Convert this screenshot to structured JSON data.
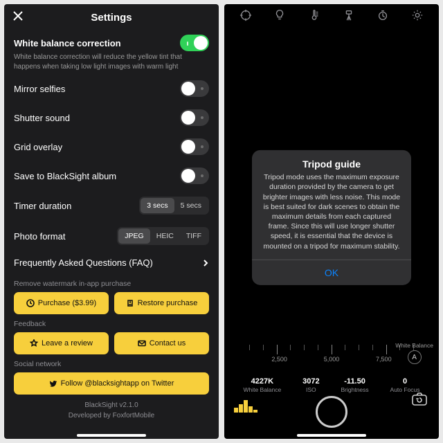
{
  "settings": {
    "title": "Settings",
    "wb": {
      "label": "White balance correction",
      "on": true,
      "desc": "White balance correction will reduce the yellow tint that happens when taking low light images with warm light"
    },
    "mirror": {
      "label": "Mirror selfies",
      "on": false
    },
    "shutter": {
      "label": "Shutter sound",
      "on": false
    },
    "grid": {
      "label": "Grid overlay",
      "on": false
    },
    "save": {
      "label": "Save to BlackSight album",
      "on": false
    },
    "timer": {
      "label": "Timer duration",
      "options": [
        "3 secs",
        "5 secs"
      ],
      "selected": 0
    },
    "format": {
      "label": "Photo format",
      "options": [
        "JPEG",
        "HEIC",
        "TIFF"
      ],
      "selected": 0
    },
    "faq": {
      "label": "Frequently Asked Questions (FAQ)"
    },
    "iap": {
      "header": "Remove watermark in-app purchase",
      "purchase": "Purchase ($3.99)",
      "restore": "Restore purchase"
    },
    "feedback": {
      "header": "Feedback",
      "review": "Leave a review",
      "contact": "Contact us"
    },
    "social": {
      "header": "Social network",
      "follow": "Follow @blacksightapp on Twitter"
    },
    "footer": {
      "version": "BlackSight v2.1.0",
      "dev": "Developed by FoxfortMobile"
    }
  },
  "camera": {
    "top_icons": [
      "focus-icon",
      "bulb-icon",
      "temperature-icon",
      "tripod-icon",
      "timer-icon",
      "settings-icon"
    ],
    "modal": {
      "title": "Tripod guide",
      "body": "Tripod mode uses the maximum exposure duration provided by the camera to get brighter images with less noise. This mode is best suited for dark scenes to obtain the maximum details from each captured frame. Since this will use longer shutter speed, it is essential that the device is mounted on a tripod for maximum stability.",
      "ok": "OK"
    },
    "ruler_labels": [
      "2,500",
      "5,000",
      "7,500"
    ],
    "wb_side": {
      "label": "White Balance",
      "badge": "A"
    },
    "stats": [
      {
        "v": "4227K",
        "k": "White Balance"
      },
      {
        "v": "3072",
        "k": "ISO"
      },
      {
        "v": "-11.50",
        "k": "Brightness"
      },
      {
        "v": "0",
        "k": "Auto Focus"
      }
    ]
  }
}
